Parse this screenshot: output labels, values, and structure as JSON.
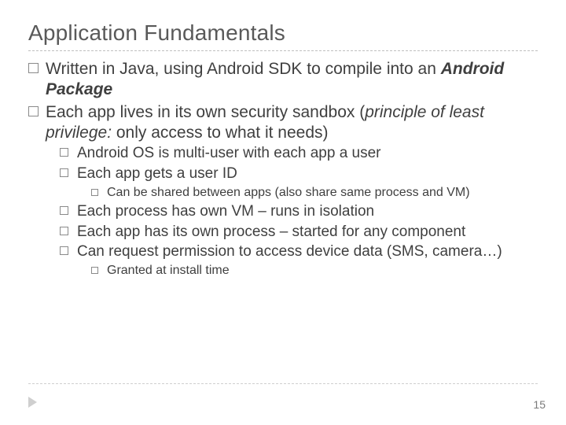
{
  "title": "Application Fundamentals",
  "page_number": "15",
  "bullets": {
    "b1_pre": "Written in Java, using Android SDK to compile into an ",
    "b1_bi": "Android Package",
    "b2_pre": "Each app lives in its own security sandbox (",
    "b2_it": "principle of least privilege:",
    "b2_post": " only access to what it needs)",
    "b2a": "Android OS is multi-user with each app a user",
    "b2b": "Each app gets a user ID",
    "b2b1": "Can be shared between apps (also share same process and VM)",
    "b2c": "Each process has own VM – runs in isolation",
    "b2d": "Each app has its own process – started for any component",
    "b2e": "Can request permission to access device data (SMS, camera…)",
    "b2e1": "Granted at install time"
  }
}
